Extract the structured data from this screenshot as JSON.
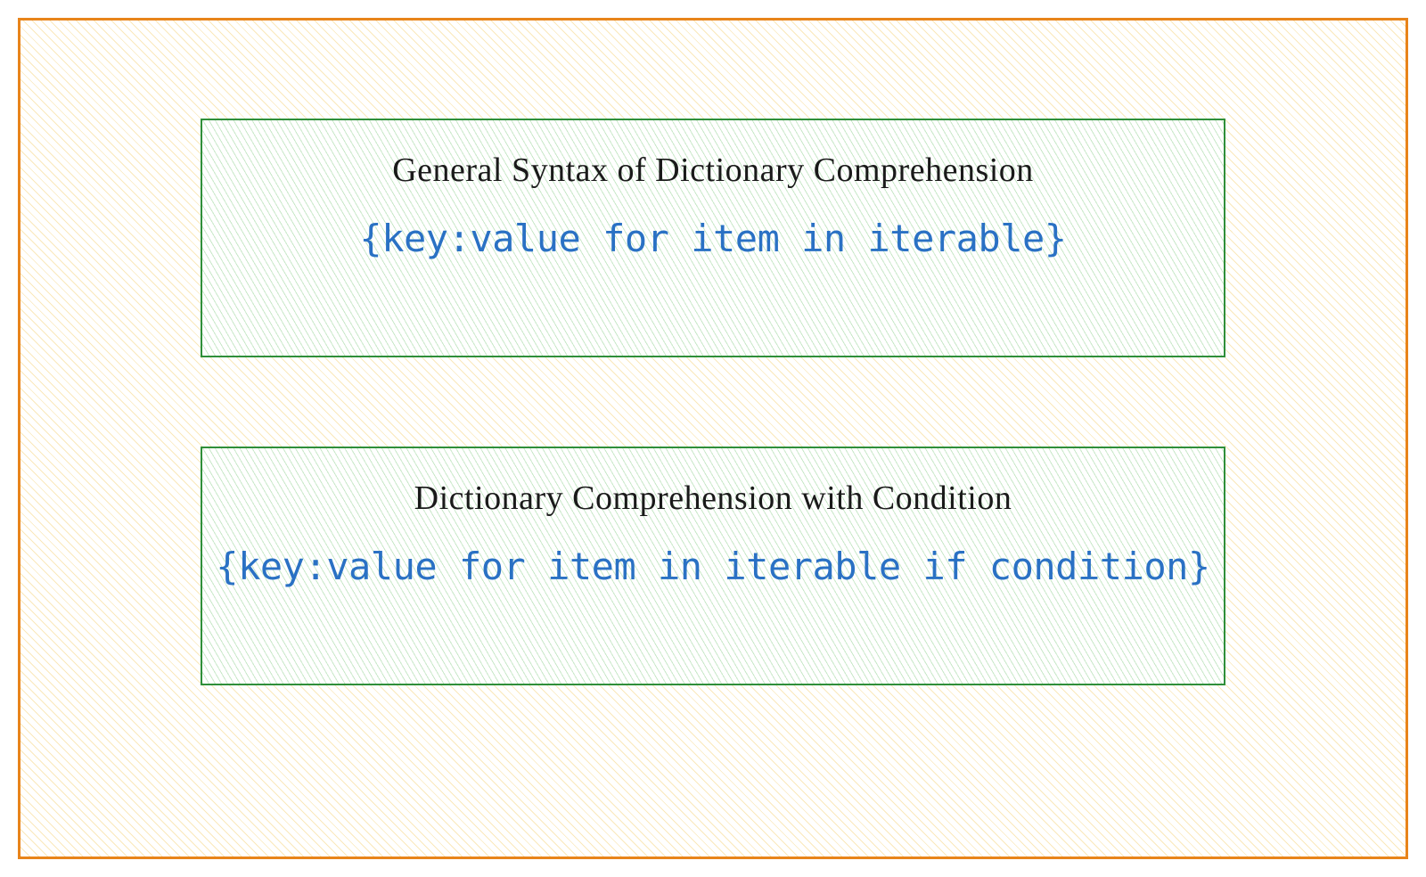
{
  "boxes": [
    {
      "title": "General Syntax of Dictionary Comprehension",
      "code": "{key:value for item in iterable}"
    },
    {
      "title": "Dictionary Comprehension with Condition",
      "code": "{key:value for item in iterable if condition}"
    }
  ]
}
